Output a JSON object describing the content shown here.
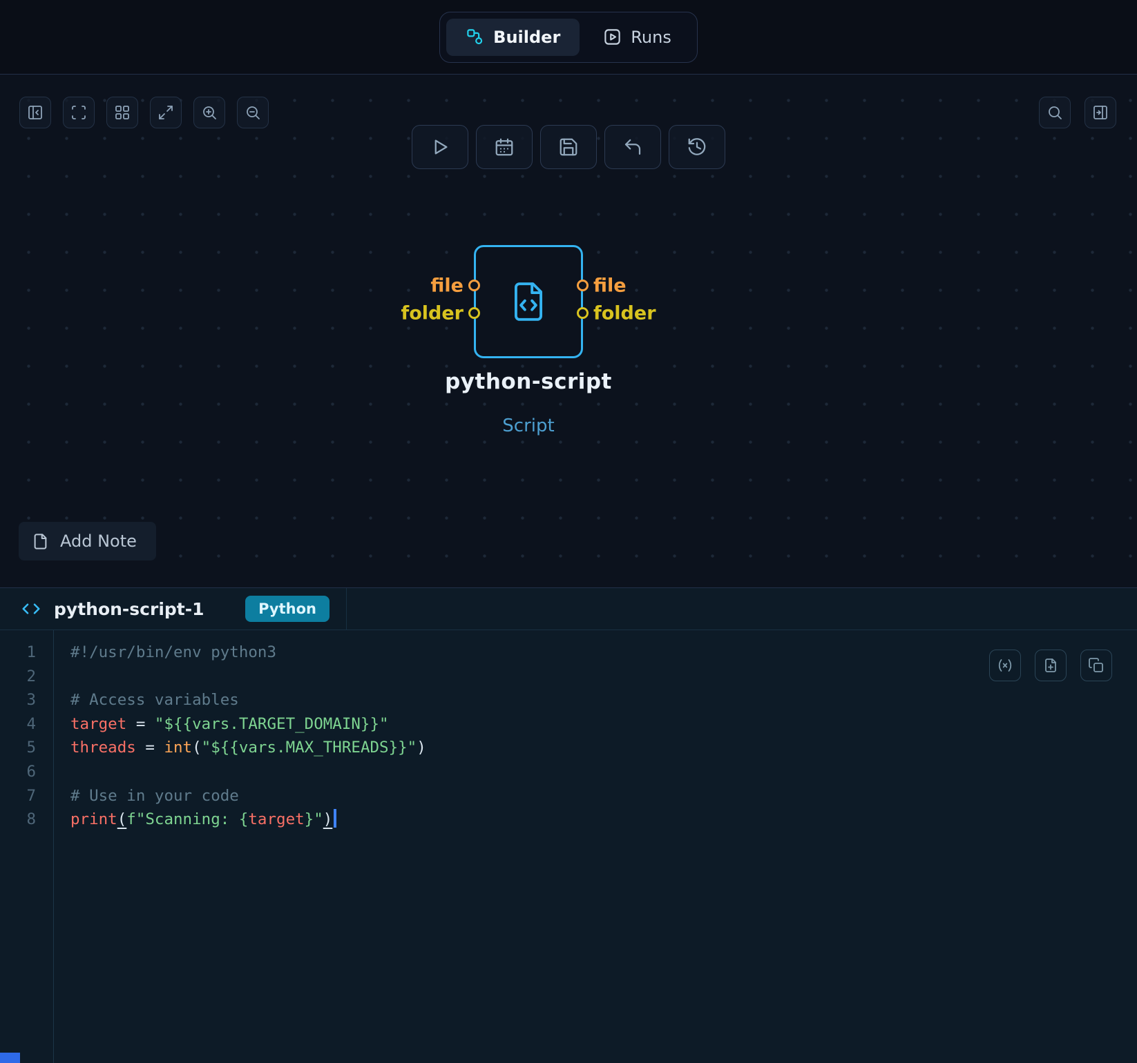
{
  "colors": {
    "accent_cyan": "#38bdf8",
    "node_border": "#34b3f1",
    "file_port": "#f59e3f",
    "folder_port": "#d8c31f",
    "badge_bg": "#0d7ea0",
    "cursor_blue": "#3f83f8"
  },
  "header": {
    "tabs": [
      {
        "label": "Builder",
        "icon": "workflow-icon",
        "active": true
      },
      {
        "label": "Runs",
        "icon": "play-square-icon",
        "active": false
      }
    ]
  },
  "canvas": {
    "toolbar_left_icons": [
      "collapse-panel-left",
      "fit-frame",
      "layout-grid",
      "expand-view",
      "zoom-in",
      "zoom-out"
    ],
    "action_toolbar_icons": [
      "run",
      "schedule",
      "save",
      "undo",
      "history"
    ],
    "toolbar_right_icons": [
      "search",
      "open-right-panel"
    ],
    "node": {
      "title": "python-script",
      "subtitle": "Script",
      "input_ports": [
        {
          "label": "file",
          "color": "#f59e3f"
        },
        {
          "label": "folder",
          "color": "#d8c31f"
        }
      ],
      "output_ports": [
        {
          "label": "file",
          "color": "#f59e3f"
        },
        {
          "label": "folder",
          "color": "#d8c31f"
        }
      ]
    },
    "add_note_label": "Add Note"
  },
  "editor": {
    "title": "python-script-1",
    "language": "Python",
    "action_icons": [
      "variables",
      "insert-file",
      "copy"
    ],
    "code": {
      "lines": [
        {
          "num": 1,
          "tokens": [
            {
              "t": "#!/usr/bin/env python3",
              "c": "comment"
            }
          ]
        },
        {
          "num": 2,
          "tokens": []
        },
        {
          "num": 3,
          "tokens": [
            {
              "t": "# Access variables",
              "c": "comment"
            }
          ]
        },
        {
          "num": 4,
          "tokens": [
            {
              "t": "target",
              "c": "var"
            },
            {
              "t": " = ",
              "c": "plain"
            },
            {
              "t": "\"${{vars.TARGET_DOMAIN}}\"",
              "c": "str"
            }
          ]
        },
        {
          "num": 5,
          "tokens": [
            {
              "t": "threads",
              "c": "var"
            },
            {
              "t": " = ",
              "c": "plain"
            },
            {
              "t": "int",
              "c": "fn"
            },
            {
              "t": "(",
              "c": "plain"
            },
            {
              "t": "\"${{vars.MAX_THREADS}}\"",
              "c": "str"
            },
            {
              "t": ")",
              "c": "plain"
            }
          ]
        },
        {
          "num": 6,
          "tokens": []
        },
        {
          "num": 7,
          "tokens": [
            {
              "t": "# Use in your code",
              "c": "comment"
            }
          ]
        },
        {
          "num": 8,
          "cursor": true,
          "tokens": [
            {
              "t": "print",
              "c": "var"
            },
            {
              "t": "(",
              "c": "plain",
              "u": true
            },
            {
              "t": "f\"Scanning: ",
              "c": "str"
            },
            {
              "t": "{",
              "c": "str"
            },
            {
              "t": "target",
              "c": "var"
            },
            {
              "t": "}",
              "c": "str"
            },
            {
              "t": "\"",
              "c": "str"
            },
            {
              "t": ")",
              "c": "plain",
              "u": true
            }
          ]
        }
      ]
    }
  }
}
